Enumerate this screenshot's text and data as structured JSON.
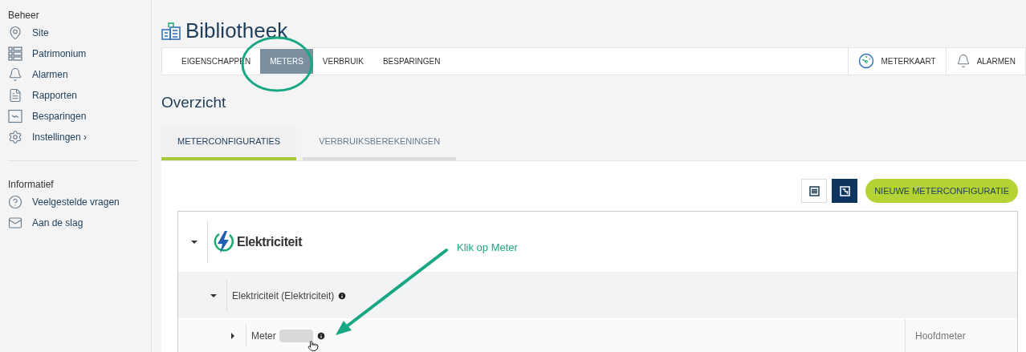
{
  "sidebar": {
    "sections": [
      {
        "heading": "Beheer",
        "items": [
          {
            "label": "Site"
          },
          {
            "label": "Patrimonium"
          },
          {
            "label": "Alarmen"
          },
          {
            "label": "Rapporten"
          },
          {
            "label": "Besparingen"
          },
          {
            "label": "Instellingen ›"
          }
        ]
      },
      {
        "heading": "Informatief",
        "items": [
          {
            "label": "Veelgestelde vragen"
          },
          {
            "label": "Aan de slag"
          }
        ]
      }
    ]
  },
  "page": {
    "title": "Bibliotheek"
  },
  "tabs": [
    {
      "label": "EIGENSCHAPPEN",
      "selected": false
    },
    {
      "label": "METERS",
      "selected": true
    },
    {
      "label": "VERBRUIK",
      "selected": false
    },
    {
      "label": "BESPARINGEN",
      "selected": false
    }
  ],
  "tab_actions": [
    {
      "label": "METERKAART"
    },
    {
      "label": "ALARMEN"
    }
  ],
  "section_title": "Overzicht",
  "subtabs": [
    {
      "label": "METERCONFIGURATIES",
      "selected": true
    },
    {
      "label": "VERBRUIKSBEREKENINGEN",
      "selected": false
    }
  ],
  "view_toggles": [
    {
      "selected": false
    },
    {
      "selected": true
    }
  ],
  "new_button": "NIEUWE METERCONFIGURATIE",
  "tree": [
    {
      "kind": "category",
      "label": "Elektriciteit",
      "expanded": true,
      "children": [
        {
          "kind": "group",
          "label": "Elektriciteit (Elektriciteit)",
          "expanded": true,
          "children": [
            {
              "kind": "meter",
              "label": "Meter",
              "expanded": false,
              "redacted": true,
              "type": "Hoofdmeter"
            }
          ]
        }
      ]
    }
  ],
  "annotation": {
    "text": "Klik op Meter"
  }
}
